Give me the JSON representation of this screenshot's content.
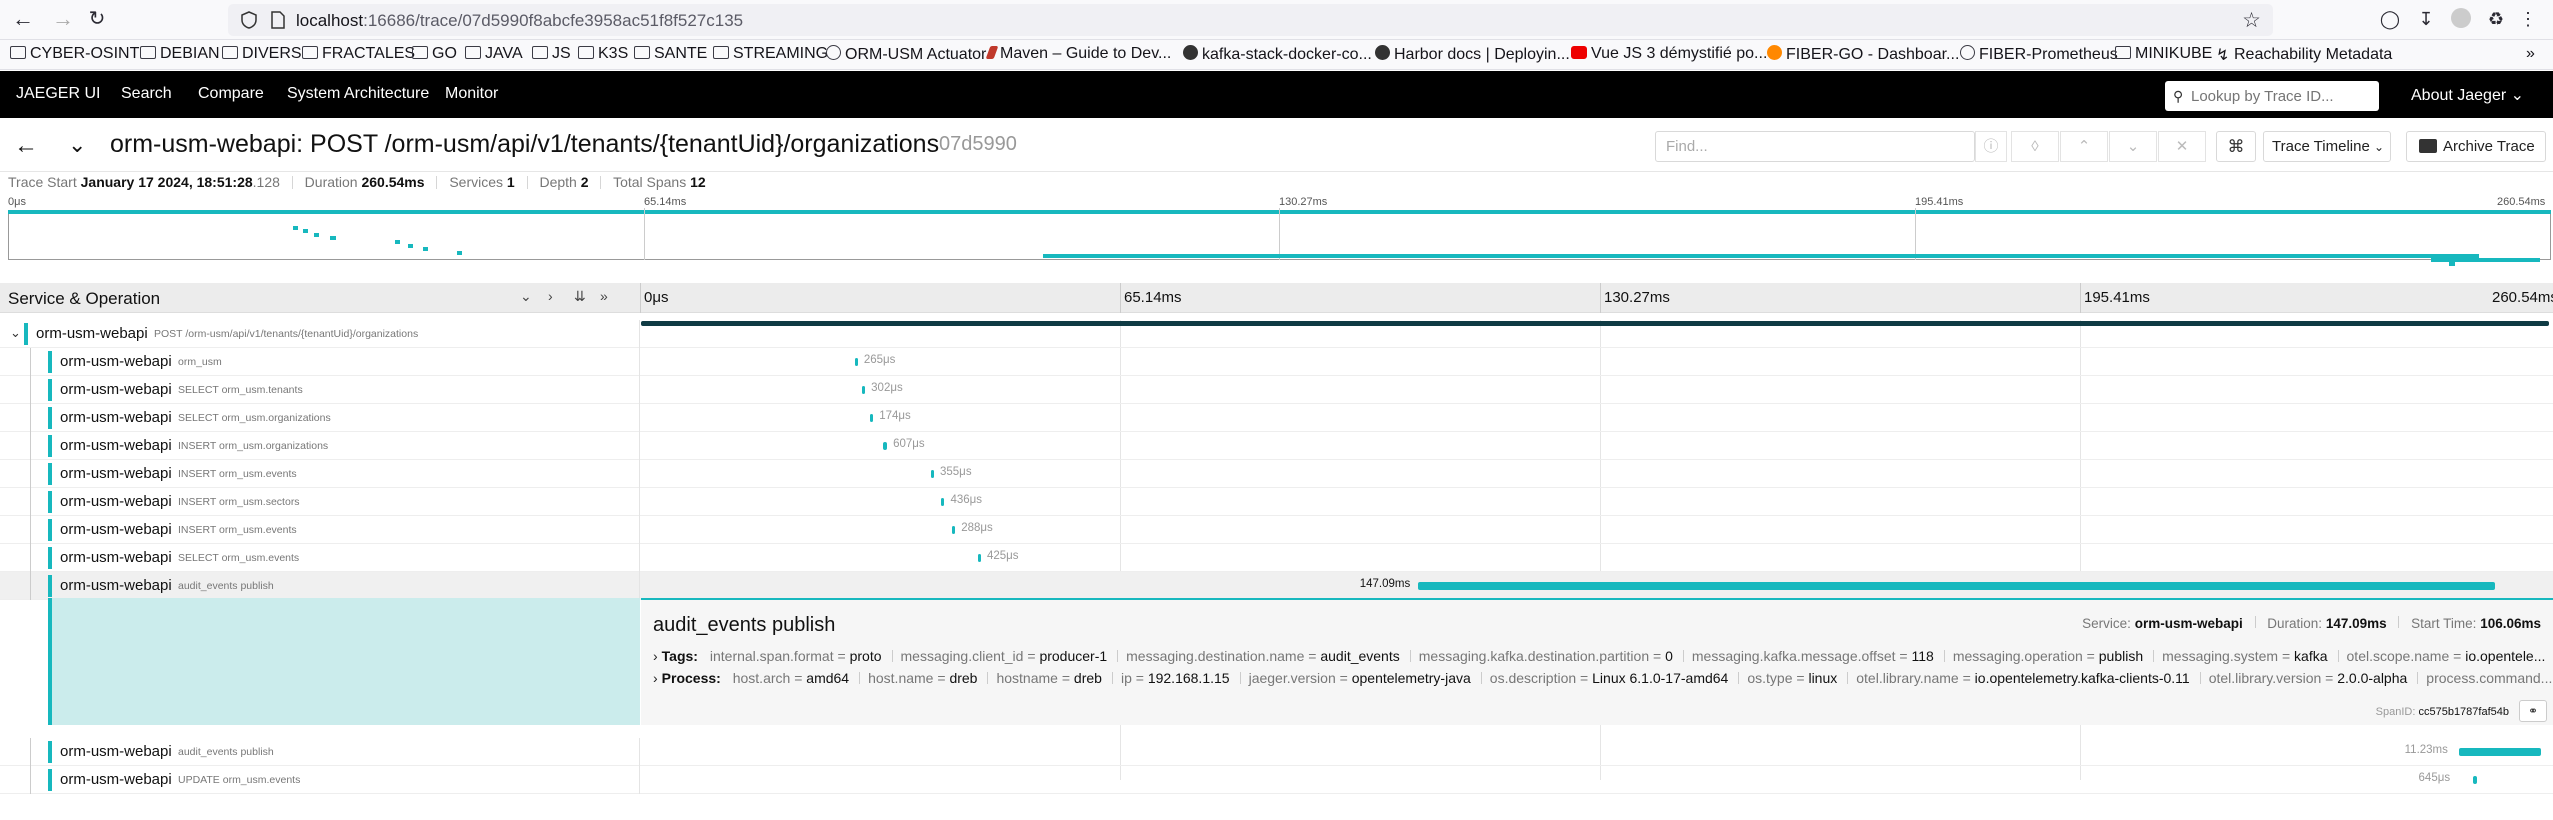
{
  "browser": {
    "url_host": "localhost",
    "url_path": ":16686/trace/07d5990f8abcfe3958ac51f8f527c135",
    "bookmarks": [
      {
        "label": "CYBER-OSINT",
        "icon": "folder-icon"
      },
      {
        "label": "DEBIAN",
        "icon": "folder-icon"
      },
      {
        "label": "DIVERS",
        "icon": "folder-icon"
      },
      {
        "label": "FRACTALES",
        "icon": "folder-icon"
      },
      {
        "label": "GO",
        "icon": "folder-icon"
      },
      {
        "label": "JAVA",
        "icon": "folder-icon"
      },
      {
        "label": "JS",
        "icon": "folder-icon"
      },
      {
        "label": "K3S",
        "icon": "folder-icon"
      },
      {
        "label": "SANTE",
        "icon": "folder-icon"
      },
      {
        "label": "STREAMING",
        "icon": "folder-icon"
      },
      {
        "label": "ORM-USM Actuator",
        "icon": "globe-icon"
      },
      {
        "label": "Maven – Guide to Dev...",
        "icon": "maven-icon"
      },
      {
        "label": "kafka-stack-docker-co...",
        "icon": "github-icon"
      },
      {
        "label": "Harbor docs | Deployin...",
        "icon": "harbor-icon"
      },
      {
        "label": "Vue JS 3 démystifié po...",
        "icon": "youtube-icon"
      },
      {
        "label": "FIBER-GO - Dashboar...",
        "icon": "grafana-icon"
      },
      {
        "label": "FIBER-Prometheus",
        "icon": "globe-icon"
      },
      {
        "label": "MINIKUBE",
        "icon": "folder-icon"
      },
      {
        "label": "Reachability Metadata",
        "icon": "reachability-icon"
      }
    ]
  },
  "jaeger_nav": {
    "brand": "JAEGER UI",
    "items": [
      "Search",
      "Compare",
      "System Architecture",
      "Monitor"
    ],
    "lookup_placeholder": "Lookup by Trace ID...",
    "about": "About Jaeger"
  },
  "trace": {
    "title": "orm-usm-webapi: POST /orm-usm/api/v1/tenants/{tenantUid}/organizations",
    "id_short": "07d5990",
    "find_placeholder": "Find...",
    "view_mode": "Trace Timeline",
    "archive_label": "Archive Trace",
    "meta": {
      "start_label": "Trace Start",
      "start_value": "January 17 2024, 18:51:28",
      "start_ms": ".128",
      "duration_label": "Duration",
      "duration_value": "260.54ms",
      "services_label": "Services",
      "services_value": "1",
      "depth_label": "Depth",
      "depth_value": "2",
      "total_spans_label": "Total Spans",
      "total_spans_value": "12"
    },
    "ticks": [
      "0μs",
      "65.14ms",
      "130.27ms",
      "195.41ms",
      "260.54ms"
    ],
    "total_ms": 260.54
  },
  "spans_header": {
    "label": "Service & Operation"
  },
  "spans": [
    {
      "service": "orm-usm-webapi",
      "operation": "POST /orm-usm/api/v1/tenants/{tenantUid}/organizations",
      "start_ms": 0,
      "dur_ms": 260.54,
      "dur_label": "",
      "depth": 0
    },
    {
      "service": "orm-usm-webapi",
      "operation": "orm_usm",
      "start_ms": 29.2,
      "dur_ms": 0.265,
      "dur_label": "265μs",
      "depth": 1
    },
    {
      "service": "orm-usm-webapi",
      "operation": "SELECT orm_usm.tenants",
      "start_ms": 30.2,
      "dur_ms": 0.302,
      "dur_label": "302μs",
      "depth": 1
    },
    {
      "service": "orm-usm-webapi",
      "operation": "SELECT orm_usm.organizations",
      "start_ms": 31.3,
      "dur_ms": 0.174,
      "dur_label": "174μs",
      "depth": 1
    },
    {
      "service": "orm-usm-webapi",
      "operation": "INSERT orm_usm.organizations",
      "start_ms": 33.0,
      "dur_ms": 0.607,
      "dur_label": "607μs",
      "depth": 1
    },
    {
      "service": "orm-usm-webapi",
      "operation": "INSERT orm_usm.events",
      "start_ms": 39.6,
      "dur_ms": 0.355,
      "dur_label": "355μs",
      "depth": 1
    },
    {
      "service": "orm-usm-webapi",
      "operation": "INSERT orm_usm.sectors",
      "start_ms": 41.0,
      "dur_ms": 0.436,
      "dur_label": "436μs",
      "depth": 1
    },
    {
      "service": "orm-usm-webapi",
      "operation": "INSERT orm_usm.events",
      "start_ms": 42.5,
      "dur_ms": 0.288,
      "dur_label": "288μs",
      "depth": 1
    },
    {
      "service": "orm-usm-webapi",
      "operation": "SELECT orm_usm.events",
      "start_ms": 46.0,
      "dur_ms": 0.425,
      "dur_label": "425μs",
      "depth": 1
    },
    {
      "service": "orm-usm-webapi",
      "operation": "audit_events publish",
      "start_ms": 106.06,
      "dur_ms": 147.09,
      "dur_label": "147.09ms",
      "depth": 1,
      "selected": true
    },
    {
      "service": "orm-usm-webapi",
      "operation": "audit_events publish",
      "start_ms": 248.2,
      "dur_ms": 11.23,
      "dur_label": "11.23ms",
      "depth": 1
    },
    {
      "service": "orm-usm-webapi",
      "operation": "UPDATE orm_usm.events",
      "start_ms": 250.1,
      "dur_ms": 0.645,
      "dur_label": "645μs",
      "depth": 1
    }
  ],
  "detail": {
    "operation": "audit_events publish",
    "service_label": "Service:",
    "service_value": "orm-usm-webapi",
    "duration_label": "Duration:",
    "duration_value": "147.09ms",
    "start_label": "Start Time:",
    "start_value": "106.06ms",
    "tags_label": "Tags:",
    "tags": [
      {
        "k": "internal.span.format",
        "v": "proto"
      },
      {
        "k": "messaging.client_id",
        "v": "producer-1"
      },
      {
        "k": "messaging.destination.name",
        "v": "audit_events"
      },
      {
        "k": "messaging.kafka.destination.partition",
        "v": "0"
      },
      {
        "k": "messaging.kafka.message.offset",
        "v": "118"
      },
      {
        "k": "messaging.operation",
        "v": "publish"
      },
      {
        "k": "messaging.system",
        "v": "kafka"
      },
      {
        "k": "otel.scope.name",
        "v": "io.opentele..."
      }
    ],
    "process_label": "Process:",
    "process": [
      {
        "k": "host.arch",
        "v": "amd64"
      },
      {
        "k": "host.name",
        "v": "dreb"
      },
      {
        "k": "hostname",
        "v": "dreb"
      },
      {
        "k": "ip",
        "v": "192.168.1.15"
      },
      {
        "k": "jaeger.version",
        "v": "opentelemetry-java"
      },
      {
        "k": "os.description",
        "v": "Linux 6.1.0-17-amd64"
      },
      {
        "k": "os.type",
        "v": "linux"
      },
      {
        "k": "otel.library.name",
        "v": "io.opentelemetry.kafka-clients-0.11"
      },
      {
        "k": "otel.library.version",
        "v": "2.0.0-alpha"
      },
      {
        "k": "process.command...",
        "v": ""
      }
    ],
    "span_id_label": "SpanID:",
    "span_id": "cc575b1787faf54b"
  },
  "colors": {
    "accent": "#17b8be",
    "nav_bg": "#000000"
  }
}
